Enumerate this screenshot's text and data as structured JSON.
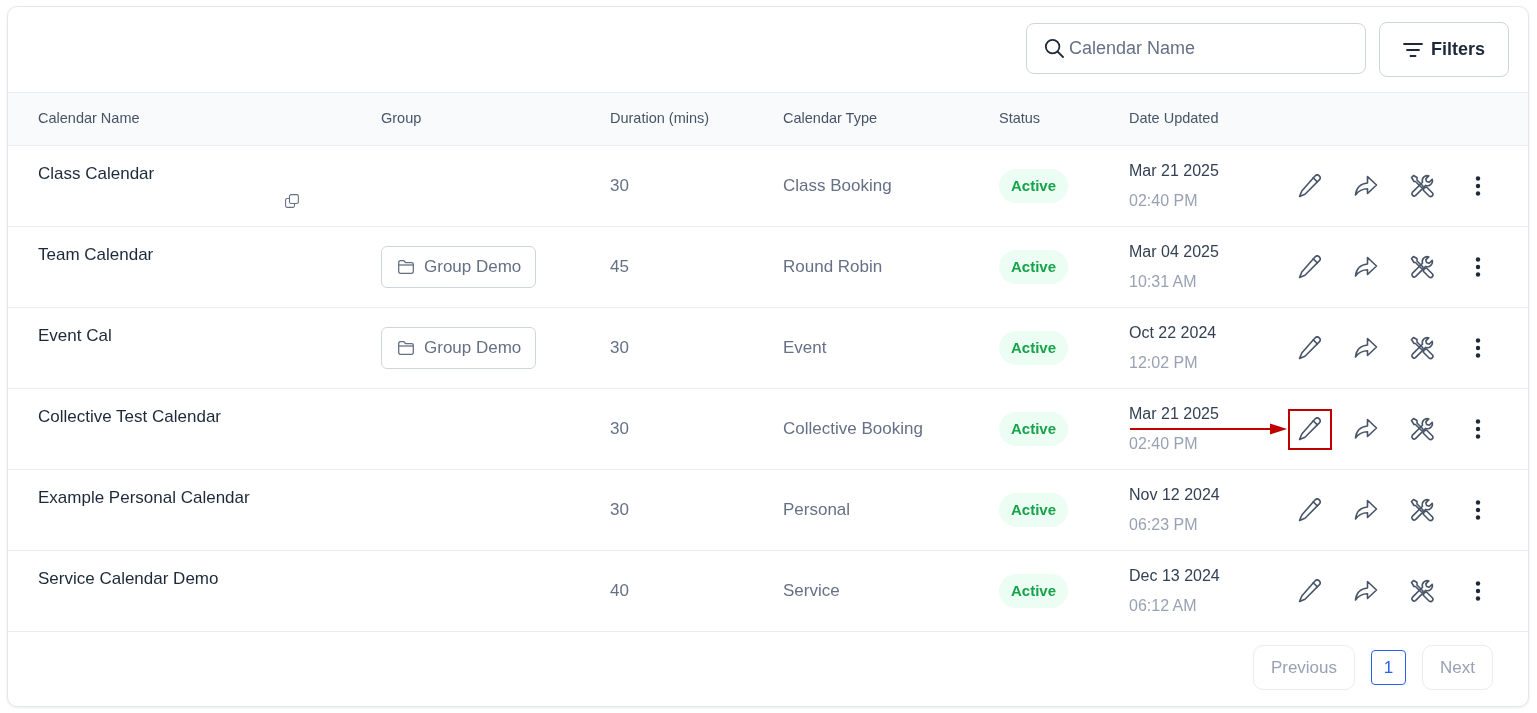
{
  "toolbar": {
    "search": {
      "placeholder": "Calendar Name"
    },
    "filters_button": {
      "label": "Filters"
    }
  },
  "table": {
    "columns": [
      "Calendar Name",
      "Group",
      "Duration (mins)",
      "Calendar Type",
      "Status",
      "Date Updated"
    ],
    "rows": [
      {
        "name": "Class Calendar",
        "copyable": true,
        "group": "",
        "duration": "30",
        "type": "Class Booking",
        "status": "Active",
        "date": "Mar 21 2025",
        "time": "02:40 PM",
        "highlighted": false
      },
      {
        "name": "Team Calendar",
        "copyable": false,
        "group": "Group Demo",
        "duration": "45",
        "type": "Round Robin",
        "status": "Active",
        "date": "Mar 04 2025",
        "time": "10:31 AM",
        "highlighted": false
      },
      {
        "name": "Event Cal",
        "copyable": false,
        "group": "Group Demo",
        "duration": "30",
        "type": "Event",
        "status": "Active",
        "date": "Oct 22 2024",
        "time": "12:02 PM",
        "highlighted": false
      },
      {
        "name": "Collective Test Calendar",
        "copyable": false,
        "group": "",
        "duration": "30",
        "type": "Collective Booking",
        "status": "Active",
        "date": "Mar 21 2025",
        "time": "02:40 PM",
        "highlighted": true
      },
      {
        "name": "Example Personal Calendar",
        "copyable": false,
        "group": "",
        "duration": "30",
        "type": "Personal",
        "status": "Active",
        "date": "Nov 12 2024",
        "time": "06:23 PM",
        "highlighted": false
      },
      {
        "name": "Service Calendar Demo",
        "copyable": false,
        "group": "",
        "duration": "40",
        "type": "Service",
        "status": "Active",
        "date": "Dec 13 2024",
        "time": "06:12 AM",
        "highlighted": false
      }
    ]
  },
  "pagination": {
    "previous": {
      "label": "Previous",
      "disabled": true
    },
    "pages": [
      {
        "label": "1",
        "selected": true
      }
    ],
    "next": {
      "label": "Next",
      "disabled": true
    }
  }
}
